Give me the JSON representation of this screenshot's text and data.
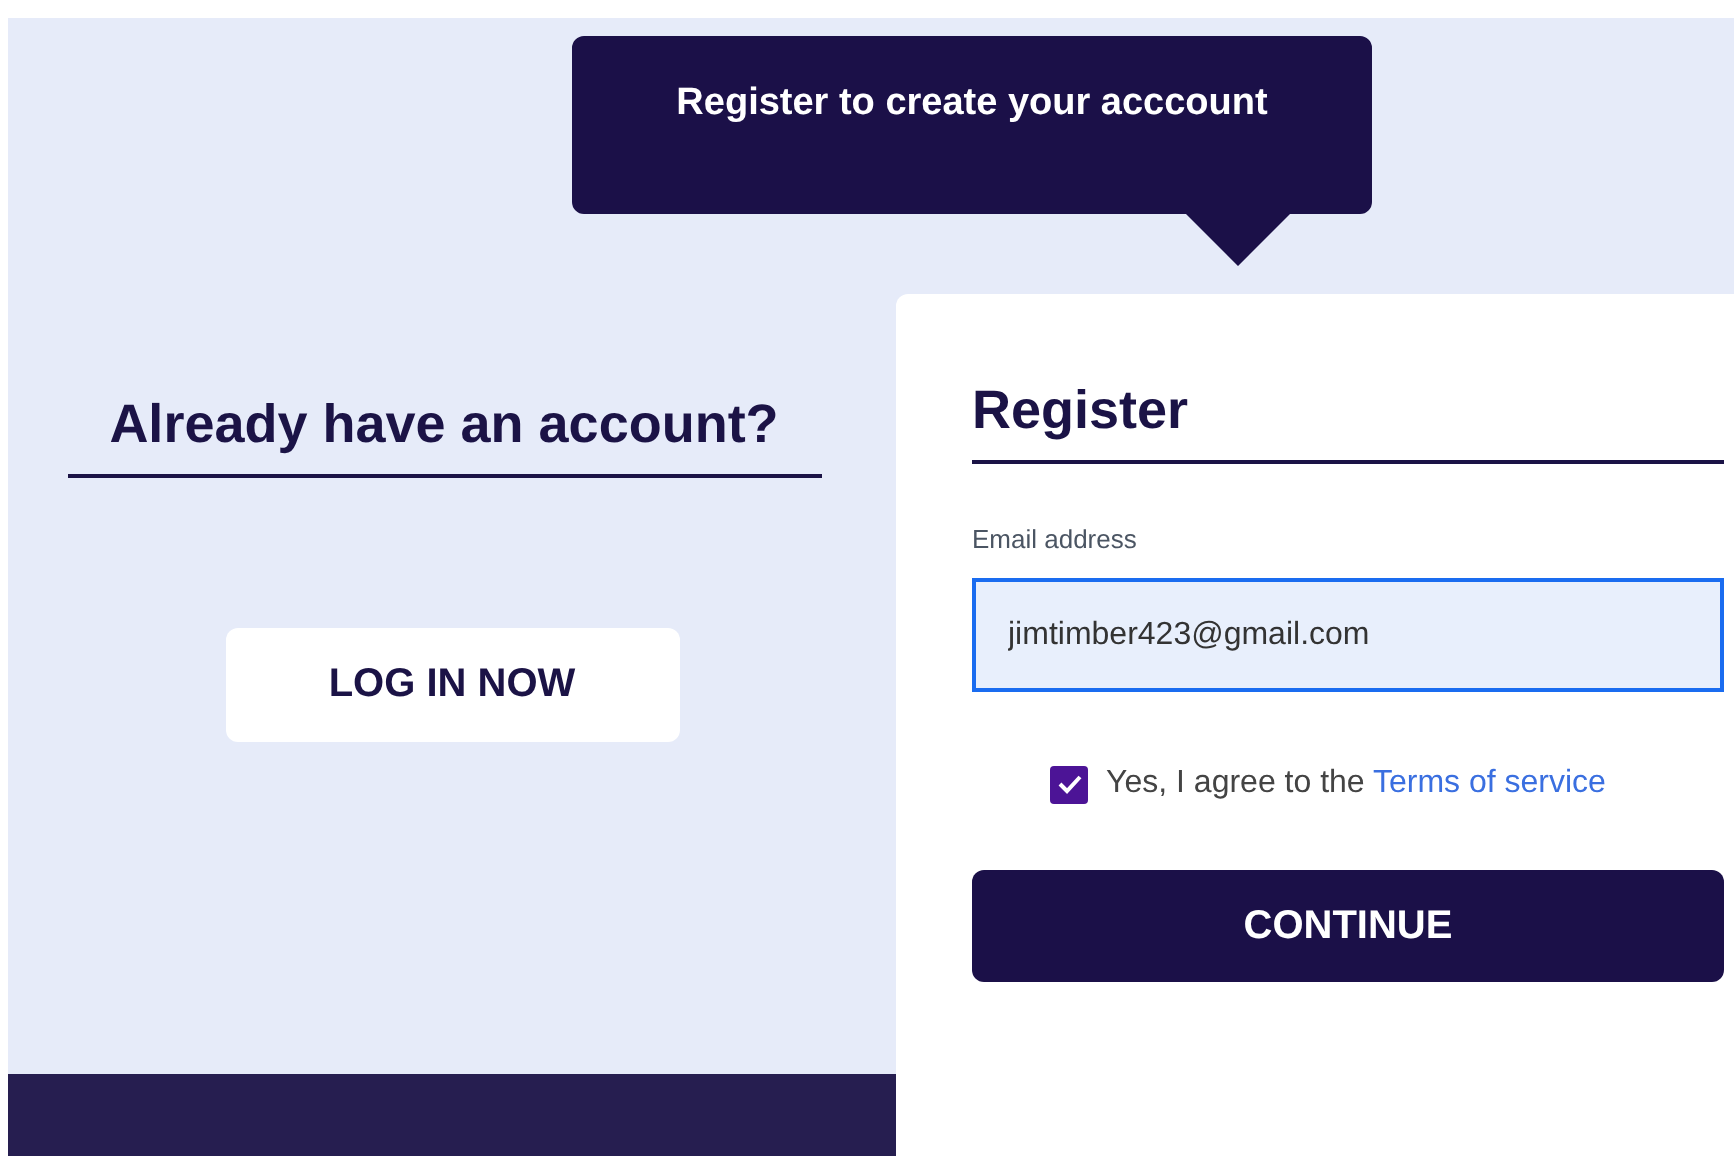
{
  "tooltip": {
    "text": "Register to create your acccount"
  },
  "login_panel": {
    "heading": "Already have an account?",
    "button": "LOG IN NOW"
  },
  "register_panel": {
    "heading": "Register",
    "email": {
      "label": "Email address",
      "value": "jimtimber423@gmail.com",
      "focused": true
    },
    "agree": {
      "text": "Yes, I agree to the",
      "link": "Terms of service",
      "checked": true
    },
    "button": "CONTINUE"
  }
}
